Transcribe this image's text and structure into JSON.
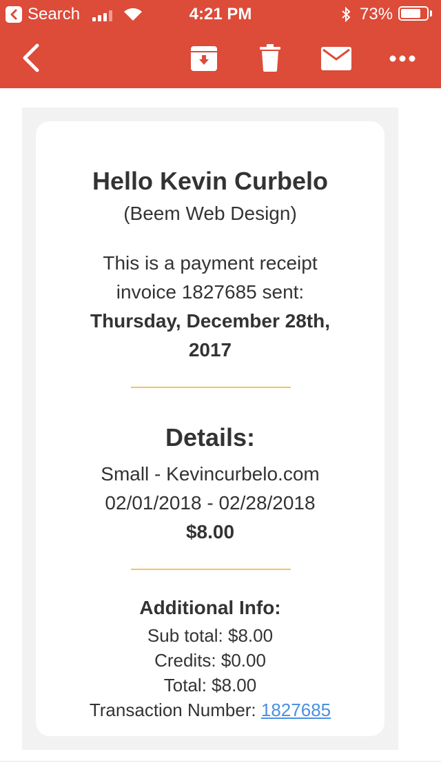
{
  "status_bar": {
    "back_label": "Search",
    "time": "4:21 PM",
    "battery": "73%",
    "icons": [
      "back-arrow-icon",
      "signal-icon",
      "wifi-icon",
      "bluetooth-icon",
      "battery-icon"
    ]
  },
  "toolbar": {
    "icons": [
      "chevron-left-icon",
      "archive-icon",
      "trash-icon",
      "mail-icon",
      "more-icon"
    ],
    "color": "#dd4b39"
  },
  "email": {
    "greeting": "Hello Kevin Curbelo",
    "company": "(Beem Web Design)",
    "intro_line1": "This is a payment receipt",
    "intro_line2": "invoice 1827685 sent:",
    "date_line1": "Thursday, December 28th,",
    "date_line2": "2017",
    "details_heading": "Details:",
    "item": "Small - Kevincurbelo.com",
    "period": "02/01/2018 - 02/28/2018",
    "amount": "$8.00",
    "additional_heading": "Additional Info:",
    "subtotal": "Sub total: $8.00",
    "credits": "Credits: $0.00",
    "total": "Total: $8.00",
    "transaction_label": "Transaction Number:",
    "transaction_number": "1827685",
    "divider_color": "#f7c15f",
    "link_color": "#4a90e2"
  }
}
